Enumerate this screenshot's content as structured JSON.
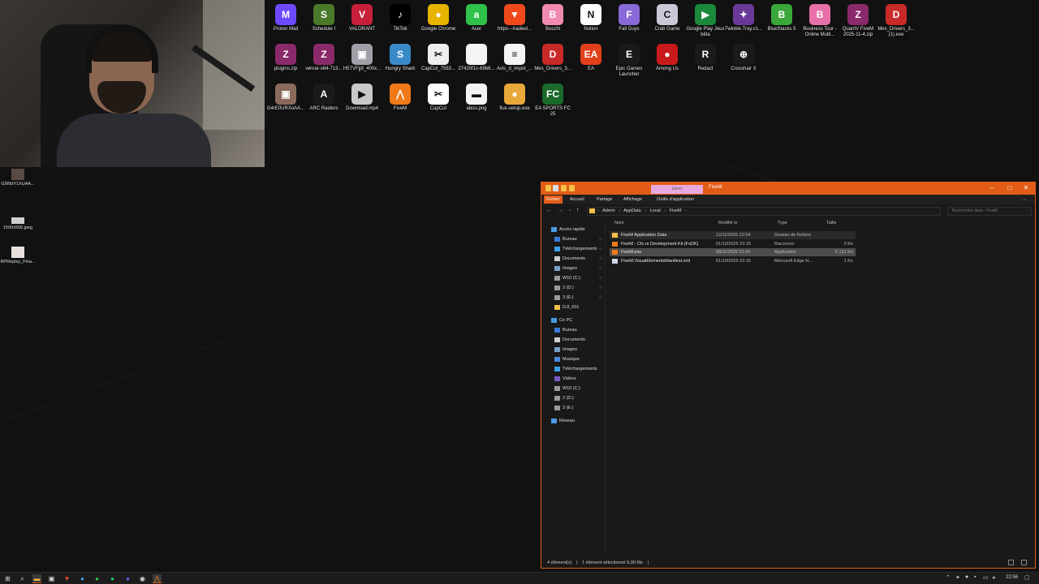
{
  "desktop": {
    "icons_row1": [
      {
        "label": "Proton Mail",
        "icon": "proton-mail-icon",
        "color": "#6d4aff",
        "glyph": "M"
      },
      {
        "label": "Schedule I",
        "icon": "schedule-one-icon",
        "color": "#4a7a2a",
        "glyph": "S"
      },
      {
        "label": "VALORANT",
        "icon": "valorant-icon",
        "color": "#c8203a",
        "glyph": "V"
      },
      {
        "label": "TikTok",
        "icon": "tiktok-icon",
        "color": "#000000",
        "glyph": "♪"
      },
      {
        "label": "Google Chrome",
        "icon": "chrome-icon",
        "color": "#e8b400",
        "glyph": "●"
      },
      {
        "label": "Acer",
        "icon": "acer-icon",
        "color": "#2fc24a",
        "glyph": "a"
      },
      {
        "label": "https---hadeel...",
        "icon": "brave-icon",
        "color": "#f04a1c",
        "glyph": "▼"
      },
      {
        "label": "Bocchi",
        "icon": "bocchi-icon",
        "color": "#f08ab0",
        "glyph": "B"
      },
      {
        "label": "Notion",
        "icon": "notion-icon",
        "color": "#ffffff",
        "glyph": "N"
      },
      {
        "label": "Fall Guys",
        "icon": "fall-guys-icon",
        "color": "#8a6ad8",
        "glyph": "F"
      },
      {
        "label": "Crab Game",
        "icon": "crab-game-icon",
        "color": "#c8c8d8",
        "glyph": "C"
      },
      {
        "label": "Google Play Jeux bêta",
        "icon": "google-play-icon",
        "color": "#1a8a3a",
        "glyph": "▶"
      },
      {
        "label": "Twinkle.Tray.v1...",
        "icon": "twinkle-tray-icon",
        "color": "#6a3a9a",
        "glyph": "✦"
      },
      {
        "label": "BlueStacks 5",
        "icon": "bluestacks-icon",
        "color": "#3aa83a",
        "glyph": "B"
      },
      {
        "label": "Business Tour - Online Multi...",
        "icon": "business-tour-icon",
        "color": "#e870a8",
        "glyph": "B"
      },
      {
        "label": "QuantV FiveM 2025-11-4.zip",
        "icon": "winrar-icon",
        "color": "#8a2a6a",
        "glyph": "Z"
      },
      {
        "label": "Mes_Drivers_3... (1).exe",
        "icon": "drivers-icon",
        "color": "#c82a2a",
        "glyph": "D"
      }
    ],
    "icons_row2": [
      {
        "label": "plugins.zip",
        "icon": "winrar-icon",
        "color": "#8a2a6a",
        "glyph": "Z"
      },
      {
        "label": "winrar-x64-713...",
        "icon": "winrar-icon",
        "color": "#8a2a6a",
        "glyph": "Z"
      },
      {
        "label": "H5TVFjj8_400x...",
        "icon": "image-file-icon",
        "color": "#a0a0a8",
        "glyph": "▣"
      },
      {
        "label": "Hungry Shark",
        "icon": "hungry-shark-icon",
        "color": "#3a8ac8",
        "glyph": "S"
      },
      {
        "label": "CapCut_7563...",
        "icon": "capcut-icon",
        "color": "#eeeeee",
        "glyph": "✂"
      },
      {
        "label": "27420f1c-69b6...",
        "icon": "file-icon",
        "color": "#f4f4f4",
        "glyph": ""
      },
      {
        "label": "Avis_d_impot_...",
        "icon": "pdf-icon",
        "color": "#f4f4f4",
        "glyph": "≡"
      },
      {
        "label": "Mes_Drivers_3...",
        "icon": "drivers-icon",
        "color": "#c82a2a",
        "glyph": "D"
      },
      {
        "label": "EA",
        "icon": "ea-icon",
        "color": "#e2401a",
        "glyph": "EA"
      },
      {
        "label": "Epic Games Launcher",
        "icon": "epic-games-icon",
        "color": "#1a1a1a",
        "glyph": "E"
      },
      {
        "label": "Among Us",
        "icon": "among-us-icon",
        "color": "#c81a1a",
        "glyph": "●"
      },
      {
        "label": "Redact",
        "icon": "redact-icon",
        "color": "#1a1a1a",
        "glyph": "R"
      },
      {
        "label": "Crosshair X",
        "icon": "crosshair-icon",
        "color": "#1a1a1a",
        "glyph": "⊕"
      }
    ],
    "icons_row3": [
      {
        "label": "G4rE0URXoAA...",
        "icon": "image-file-icon",
        "color": "#8a6a5a",
        "glyph": "▣"
      },
      {
        "label": "ARC Raiders",
        "icon": "arc-raiders-icon",
        "color": "#1a1a1a",
        "glyph": "A"
      },
      {
        "label": "Download.mp4",
        "icon": "video-file-icon",
        "color": "#c8c8c8",
        "glyph": "▶"
      },
      {
        "label": "FiveM",
        "icon": "fivem-icon",
        "color": "#f07a1a",
        "glyph": "⋀"
      },
      {
        "label": "CapCut",
        "icon": "capcut-icon",
        "color": "#ffffff",
        "glyph": "✂"
      },
      {
        "label": "abou.png",
        "icon": "image-file-icon",
        "color": "#f4f4f4",
        "glyph": "▬"
      },
      {
        "label": "flux-setup.exe",
        "icon": "flux-icon",
        "color": "#e8a83a",
        "glyph": "●"
      },
      {
        "label": "EA SPORTS FC 25",
        "icon": "fc25-icon",
        "color": "#1a6a2a",
        "glyph": "FC"
      }
    ],
    "left_icons": [
      {
        "label": "G5f9dY1XUAA...",
        "icon": "image-file-icon"
      },
      {
        "label": "1500x500.jpeg",
        "icon": "image-file-icon"
      },
      {
        "label": "RPReplay_Fina...",
        "icon": "video-file-icon"
      }
    ]
  },
  "explorer": {
    "title": "FiveM",
    "manage_tab": "Gérer",
    "ribbon_tabs": [
      "Fichier",
      "Accueil",
      "Partage",
      "Affichage",
      "Outils d'application"
    ],
    "breadcrumb": [
      "Admin",
      "AppData",
      "Local",
      "FiveM"
    ],
    "search_placeholder": "Rechercher dans : FiveM",
    "nav": {
      "quick_access": "Accès rapide",
      "quick_items": [
        "Bureau",
        "Téléchargements",
        "Documents",
        "Images",
        "W10 (C:)",
        "2 (D:)",
        "3 (E:)",
        "DJI_001"
      ],
      "this_pc": "Ce PC",
      "pc_items": [
        "Bureau",
        "Documents",
        "Images",
        "Musique",
        "Téléchargements",
        "Vidéos",
        "W10 (C:)",
        "2 (D:)",
        "3 (E:)"
      ],
      "network": "Réseau"
    },
    "columns": {
      "name": "Nom",
      "modified": "Modifié le",
      "type": "Type",
      "size": "Taille"
    },
    "files": [
      {
        "name": "FiveM Application Data",
        "modified": "12/11/2025 22:54",
        "type": "Dossier de fichiers",
        "size": ""
      },
      {
        "name": "FiveM - Cfx.re Development Kit (FxDK)",
        "modified": "01/10/2025 23:15",
        "type": "Raccourci",
        "size": "3 Ko"
      },
      {
        "name": "FiveM.exe",
        "modified": "08/11/2025 21:43",
        "type": "Application",
        "size": "5 131 Ko"
      },
      {
        "name": "FiveM.VisualElementsManifest.xml",
        "modified": "01/10/2025 23:15",
        "type": "Microsoft Edge H...",
        "size": "1 Ko"
      }
    ],
    "status": {
      "count": "4 élément(s)",
      "selected": "1 élément sélectionné 5,00 Mo"
    }
  },
  "taskbar": {
    "time": "22:56"
  },
  "colors": {
    "accent": "#e25c18",
    "folder": "#f3c04a"
  }
}
